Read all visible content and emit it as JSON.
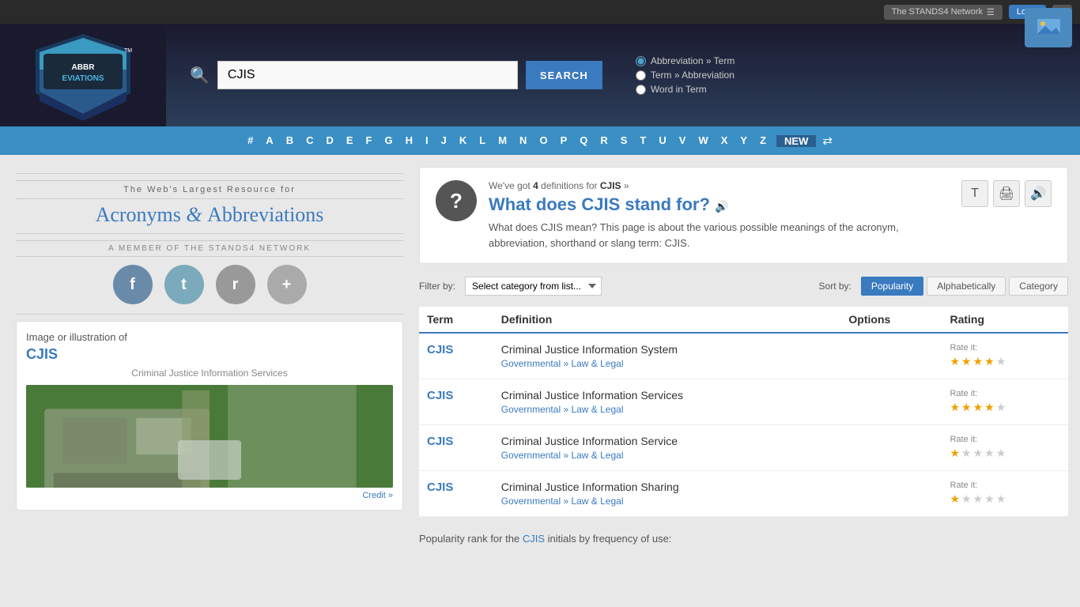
{
  "topbar": {
    "network_label": "The STANDS4 Network",
    "login_label": "Login",
    "history_label": "⟲"
  },
  "header": {
    "logo_text": "ABBREVIATIONS",
    "logo_tm": "™",
    "search_value": "CJIS",
    "search_placeholder": "CJIS",
    "search_button": "SEARCH",
    "radio_options": [
      {
        "label": "Abbreviation » Term",
        "checked": true
      },
      {
        "label": "Term » Abbreviation",
        "checked": false
      },
      {
        "label": "Word in Term",
        "checked": false
      }
    ]
  },
  "navbar": {
    "links": [
      "#",
      "A",
      "B",
      "C",
      "D",
      "E",
      "F",
      "G",
      "H",
      "I",
      "J",
      "K",
      "L",
      "M",
      "N",
      "O",
      "P",
      "Q",
      "R",
      "S",
      "T",
      "U",
      "V",
      "W",
      "X",
      "Y",
      "Z"
    ],
    "new_label": "NEW"
  },
  "sidebar": {
    "tagline": "The Web's Largest Resource for",
    "title": "Acronyms & Abbreviations",
    "subtitle": "A MEMBER OF THE STANDS4 NETWORK",
    "social": [
      {
        "name": "facebook",
        "symbol": "f"
      },
      {
        "name": "twitter",
        "symbol": "t"
      },
      {
        "name": "reddit",
        "symbol": "r"
      },
      {
        "name": "plus",
        "symbol": "+"
      }
    ],
    "image_card": {
      "title": "Image or illustration of",
      "abbr": "CJIS",
      "caption": "Criminal Justice Information Services",
      "credit": "Credit »"
    }
  },
  "result": {
    "count_text": "We've got",
    "count": "4",
    "count_suffix": "definitions for",
    "term": "CJIS",
    "title": "What does CJIS stand for?",
    "description": "What does CJIS mean? This page is about the various possible meanings of the acronym, abbreviation, shorthand or slang term: CJIS."
  },
  "filter": {
    "label": "Filter by:",
    "placeholder": "Select category from list...",
    "sort_label": "Sort by:",
    "sort_options": [
      "Popularity",
      "Alphabetically",
      "Category"
    ]
  },
  "table": {
    "columns": [
      "Term",
      "Definition",
      "Options",
      "Rating"
    ],
    "rows": [
      {
        "term": "CJIS",
        "definition": "Criminal Justice Information System",
        "category": "Governmental » Law & Legal",
        "stars": [
          true,
          true,
          true,
          true,
          false
        ],
        "rate_label": "Rate it:"
      },
      {
        "term": "CJIS",
        "definition": "Criminal Justice Information Services",
        "category": "Governmental » Law & Legal",
        "stars": [
          true,
          true,
          true,
          true,
          false
        ],
        "rate_label": "Rate it:"
      },
      {
        "term": "CJIS",
        "definition": "Criminal Justice Information Service",
        "category": "Governmental » Law & Legal",
        "stars": [
          true,
          false,
          false,
          false,
          false
        ],
        "rate_label": "Rate it:"
      },
      {
        "term": "CJIS",
        "definition": "Criminal Justice Information Sharing",
        "category": "Governmental » Law & Legal",
        "stars": [
          true,
          false,
          false,
          false,
          false
        ],
        "rate_label": "Rate it:"
      }
    ]
  },
  "popularity": {
    "text": "Popularity rank for the",
    "term": "CJIS",
    "suffix": "initials by frequency of use:"
  }
}
